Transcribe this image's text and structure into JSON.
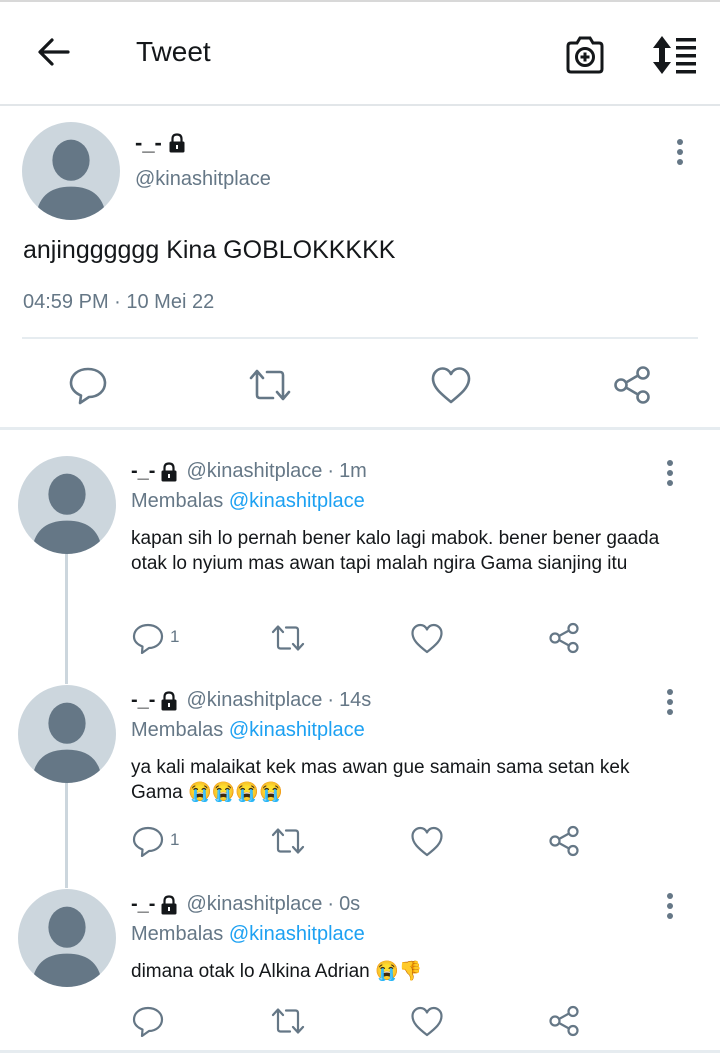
{
  "header": {
    "title": "Tweet",
    "back_icon": "arrow-left-icon",
    "camera_icon": "camera-plus-icon",
    "sort_icon": "sort-list-icon"
  },
  "colors": {
    "text": "#14171a",
    "muted": "#657786",
    "accent": "#1da1f2",
    "divider": "#e6ecf0",
    "avatar_bg": "#ccd6dd",
    "avatar_fg": "#657786"
  },
  "main_tweet": {
    "name": "-_-",
    "handle": "@kinashitplace",
    "text": "anjingggggg Kina GOBLOKKKKK",
    "timestamp": "04:59 PM · 10 Mei 22"
  },
  "replies": [
    {
      "name": "-_-",
      "handle": "@kinashitplace",
      "separator": "·",
      "time": "1m",
      "replying_prefix": "Membalas",
      "replying_to": "@kinashitplace",
      "text": "kapan sih lo pernah bener kalo lagi mabok. bener bener gaada otak lo nyium mas awan tapi malah ngira Gama sianjing itu",
      "reply_count": "1"
    },
    {
      "name": "-_-",
      "handle": "@kinashitplace",
      "separator": "·",
      "time": "14s",
      "replying_prefix": "Membalas",
      "replying_to": "@kinashitplace",
      "text": "ya kali malaikat kek mas awan gue samain sama setan kek Gama 😭😭😭😭",
      "reply_count": "1"
    },
    {
      "name": "-_-",
      "handle": "@kinashitplace",
      "separator": "·",
      "time": "0s",
      "replying_prefix": "Membalas",
      "replying_to": "@kinashitplace",
      "text": "dimana otak lo Alkina Adrian 😭👎",
      "reply_count": ""
    }
  ]
}
